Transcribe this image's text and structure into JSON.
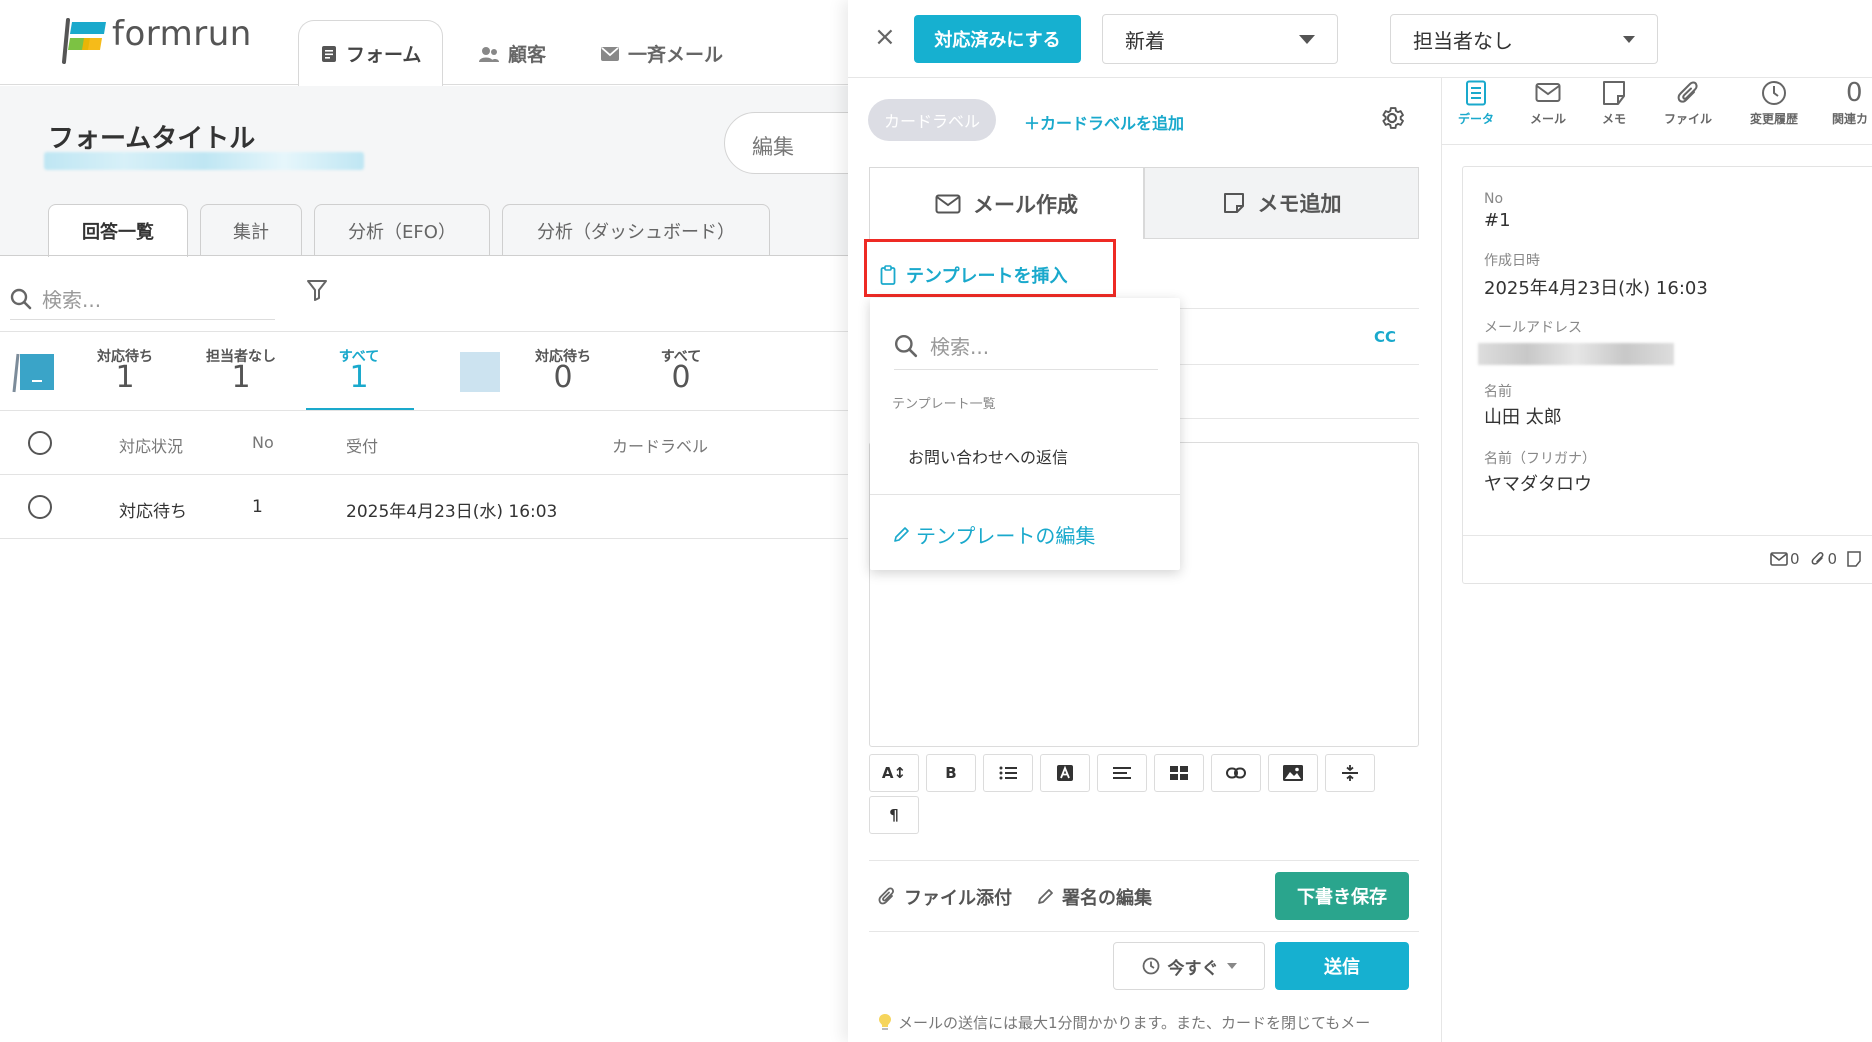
{
  "app": {
    "logo_text": "formrun",
    "nav": [
      "フォーム",
      "顧客",
      "一斉メール"
    ]
  },
  "form": {
    "title": "フォームタイトル",
    "edit_label": "編集",
    "tabs": [
      "回答一覧",
      "集計",
      "分析（EFO）",
      "分析（ダッシュボード）"
    ],
    "search_placeholder": "検索..."
  },
  "stats": [
    {
      "label": "対応待ち",
      "value": "1"
    },
    {
      "label": "担当者なし",
      "value": "1"
    },
    {
      "label": "すべて",
      "value": "1"
    },
    {
      "label": "対応待ち",
      "value": "0"
    },
    {
      "label": "すべて",
      "value": "0"
    }
  ],
  "table": {
    "headers": [
      "対応状況",
      "No",
      "受付",
      "カードラベル"
    ],
    "rows": [
      {
        "status": "対応待ち",
        "no": "1",
        "received": "2025年4月23日(水) 16:03"
      }
    ]
  },
  "panel": {
    "close": "×",
    "resolve_button": "対応済みにする",
    "status_select": "新着",
    "assignee_select": "担当者なし",
    "card_label": "カードラベル",
    "add_card_label": "＋カードラベルを追加",
    "tab_compose": "メール作成",
    "tab_memo": "メモ追加",
    "insert_template": "テンプレートを挿入",
    "cc": "CC",
    "toolbar": [
      "A↕",
      "B",
      "list",
      "A",
      "align",
      "table",
      "link",
      "image",
      "hr",
      "¶"
    ],
    "attach": "ファイル添付",
    "edit_signature": "署名の編集",
    "save_draft": "下書き保存",
    "send_time": "今すぐ",
    "send": "送信",
    "hint": "メールの送信には最大1分間かかります。また、カードを閉じてもメー"
  },
  "dropdown": {
    "search_placeholder": "検索...",
    "caption": "テンプレート一覧",
    "items": [
      "お問い合わせへの返信"
    ],
    "edit_link": "テンプレートの編集"
  },
  "side": {
    "tabs": [
      "データ",
      "メール",
      "メモ",
      "ファイル",
      "変更履歴",
      "関連カ"
    ],
    "tab_extra": "0",
    "fields": [
      {
        "label": "No",
        "value": "#1"
      },
      {
        "label": "作成日時",
        "value": "2025年4月23日(水) 16:03"
      },
      {
        "label": "メールアドレス",
        "value": ""
      },
      {
        "label": "名前",
        "value": "山田 太郎"
      },
      {
        "label": "名前（フリガナ）",
        "value": "ヤマダタロウ"
      }
    ],
    "mail_count": "0",
    "file_count": "0"
  },
  "colors": {
    "accent": "#16b0d0",
    "green": "#2aa58d",
    "highlight": "#ee2a24"
  }
}
